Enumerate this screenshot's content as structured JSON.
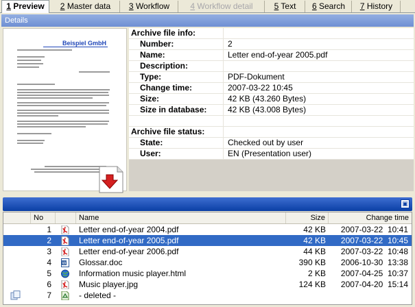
{
  "tabs": [
    {
      "key": "1",
      "rest": " Preview",
      "active": true
    },
    {
      "key": "2",
      "rest": " Master data"
    },
    {
      "key": "3",
      "rest": " Workflow"
    },
    {
      "key": "4",
      "rest": " Workflow detail",
      "disabled": true
    },
    {
      "key": "5",
      "rest": " Text"
    },
    {
      "key": "6",
      "rest": " Search"
    },
    {
      "key": "7",
      "rest": " History"
    }
  ],
  "details": {
    "header": "Details",
    "preview": {
      "brand": "Beispiel GmbH",
      "icon": "pdf-download-icon"
    },
    "archive_info": {
      "heading": "Archive file info:",
      "number_label": "Number:",
      "number": "2",
      "name_label": "Name:",
      "name": "Letter end-of-year 2005.pdf",
      "description_label": "Description:",
      "description": "",
      "type_label": "Type:",
      "type": "PDF-Dokument",
      "change_time_label": "Change time:",
      "change_time": "2007-03-22  10:45",
      "size_label": "Size:",
      "size": "42 KB  (43.260 Bytes)",
      "size_db_label": "Size in database:",
      "size_db": "42 KB  (43.008 Bytes)"
    },
    "archive_status": {
      "heading": "Archive file status:",
      "state_label": "State:",
      "state": "Checked out by user",
      "user_label": "User:",
      "user": "EN (Presentation user)"
    }
  },
  "list": {
    "columns": {
      "no": "No",
      "name": "Name",
      "size": "Size",
      "change_time": "Change time"
    },
    "rows": [
      {
        "no": "1",
        "icon": "pdf-icon",
        "name": "Letter end-of-year 2004.pdf",
        "size": "42 KB",
        "time": "2007-03-22  10:41"
      },
      {
        "no": "2",
        "icon": "pdf-icon",
        "name": "Letter end-of-year 2005.pdf",
        "size": "42 KB",
        "time": "2007-03-22  10:45",
        "selected": true
      },
      {
        "no": "3",
        "icon": "pdf-icon",
        "name": "Letter end-of-year 2006.pdf",
        "size": "44 KB",
        "time": "2007-03-22  10:48"
      },
      {
        "no": "4",
        "icon": "word-doc-icon",
        "name": "Glossar.doc",
        "size": "390 KB",
        "time": "2006-10-30  13:38"
      },
      {
        "no": "5",
        "icon": "html-globe-icon",
        "name": "Information music player.html",
        "size": "2 KB",
        "time": "2007-04-25  10:37"
      },
      {
        "no": "6",
        "icon": "jpg-image-icon",
        "name": "Music player.jpg",
        "size": "124 KB",
        "time": "2007-04-20  15:14"
      },
      {
        "no": "7",
        "icon": "recycle-icon",
        "name": "- deleted -",
        "size": "",
        "time": ""
      }
    ]
  },
  "colors": {
    "selection": "#316ac5",
    "header_blue": "#0a3fa5",
    "pdf_red": "#d42020"
  }
}
